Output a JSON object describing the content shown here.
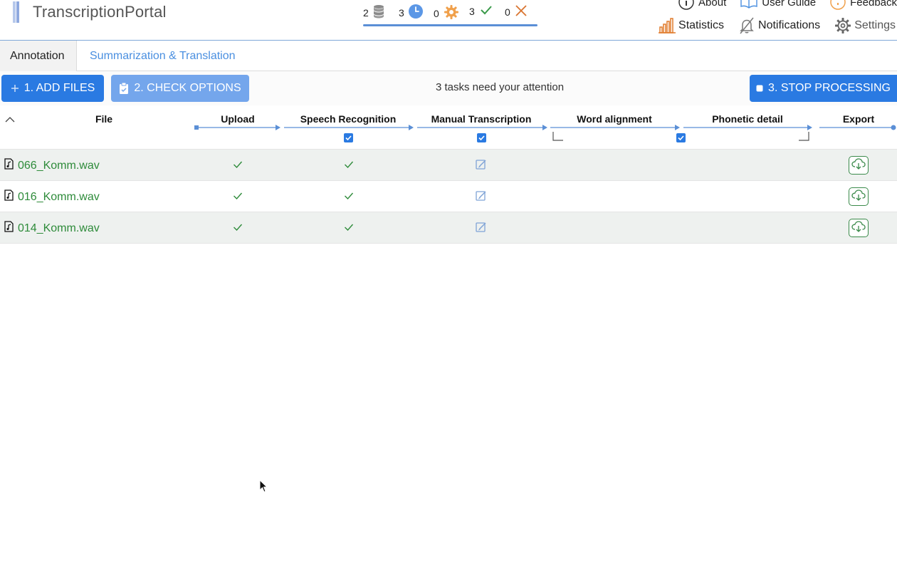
{
  "app": {
    "title": "TranscriptionPortal"
  },
  "status": {
    "queued": "2",
    "waiting": "3",
    "processing": "0",
    "done": "3",
    "failed": "0"
  },
  "top_links": {
    "about": "About",
    "user_guide": "User Guide",
    "feedback": "Feedback"
  },
  "nav": {
    "statistics": "Statistics",
    "notifications": "Notifications",
    "settings": "Settings"
  },
  "tabs": [
    {
      "label": "Annotation",
      "active": true
    },
    {
      "label": "Summarization & Translation",
      "active": false
    }
  ],
  "toolbar": {
    "add_files": "1. ADD FILES",
    "check_options": "2. CHECK OPTIONS",
    "attention": "3 tasks need your attention",
    "stop_processing": "3. STOP PROCESSING"
  },
  "columns": {
    "file": "File",
    "upload": "Upload",
    "speech_recognition": "Speech Recognition",
    "manual_transcription": "Manual Transcription",
    "word_alignment": "Word alignment",
    "phonetic_detail": "Phonetic detail",
    "export": "Export"
  },
  "options": {
    "speech_recognition": true,
    "manual_transcription": true,
    "word_alignment": false,
    "phonetic_detail": true
  },
  "files": [
    {
      "name": "066_Komm.wav",
      "upload": "done",
      "asr": "done",
      "manual": "edit"
    },
    {
      "name": "016_Komm.wav",
      "upload": "done",
      "asr": "done",
      "manual": "edit"
    },
    {
      "name": "014_Komm.wav",
      "upload": "done",
      "asr": "done",
      "manual": "edit"
    }
  ],
  "colors": {
    "primary": "#2a7ae2",
    "primary_light": "#74a6ec",
    "link": "#4a8fe0",
    "file_green": "#2e8b3a",
    "row_shade": "#eef1ef",
    "statistics_orange": "#e07a2a",
    "failed_orange": "#d9742f",
    "processing_orange": "#f0a04b"
  }
}
